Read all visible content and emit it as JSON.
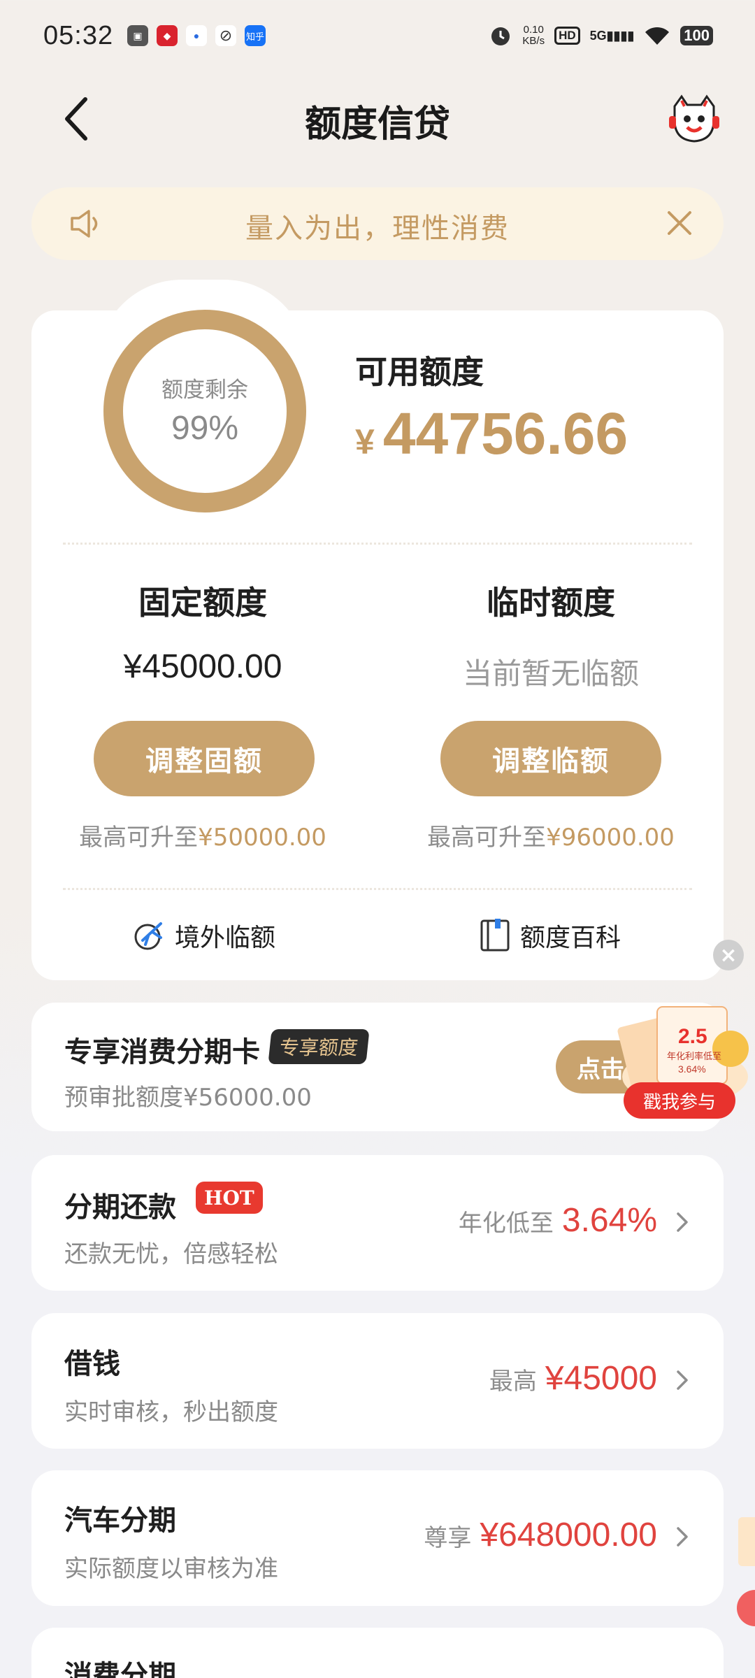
{
  "status_bar": {
    "time": "05:32",
    "app_icons": [
      "app-icon-1",
      "app-icon-2",
      "app-icon-3",
      "app-icon-4",
      "zhihu-icon"
    ],
    "zhihu_label": "知乎",
    "net_speed_value": "0.10",
    "net_speed_unit": "KB/s",
    "hd": "HD",
    "signal": "5G",
    "battery": "100"
  },
  "header": {
    "title": "额度信贷"
  },
  "notice": {
    "text": "量入为出，理性消费"
  },
  "credit": {
    "ring_label": "额度剩余",
    "ring_percent": "99%",
    "ring_fraction": 0.99,
    "available_label": "可用额度",
    "currency": "¥",
    "available_value": "44756.66",
    "fixed": {
      "title": "固定额度",
      "value": "¥45000.00",
      "button": "调整固额",
      "hint_prefix": "最高可升至",
      "hint_value": "¥50000.00"
    },
    "temp": {
      "title": "临时额度",
      "value": "当前暂无临额",
      "button": "调整临额",
      "hint_prefix": "最高可升至",
      "hint_value": "¥96000.00"
    },
    "links": {
      "overseas": "境外临额",
      "wiki": "额度百科"
    }
  },
  "installment_card": {
    "title": "专享消费分期卡",
    "badge": "专享额度",
    "subtitle": "预审批额度¥56000.00",
    "button": "点击"
  },
  "promo": {
    "close": "×",
    "badge": "2.5",
    "rate_text": "年化利率低至",
    "rate": "3.64%",
    "button": "戳我参与"
  },
  "rows": [
    {
      "title": "分期还款",
      "badge": "HOT",
      "subtitle": "还款无忧，倍感轻松",
      "prefix": "年化低至",
      "value": "3.64%"
    },
    {
      "title": "借钱",
      "badge": "",
      "subtitle": "实时审核，秒出额度",
      "prefix": "最高",
      "value": "¥45000"
    },
    {
      "title": "汽车分期",
      "badge": "",
      "subtitle": "实际额度以审核为准",
      "prefix": "尊享",
      "value": "¥648000.00"
    },
    {
      "title": "消费分期",
      "badge": "",
      "subtitle": "",
      "prefix": "",
      "value": ""
    }
  ],
  "colors": {
    "gold": "#c9a36e",
    "gold_text": "#c49a62",
    "red": "#e0433e"
  }
}
